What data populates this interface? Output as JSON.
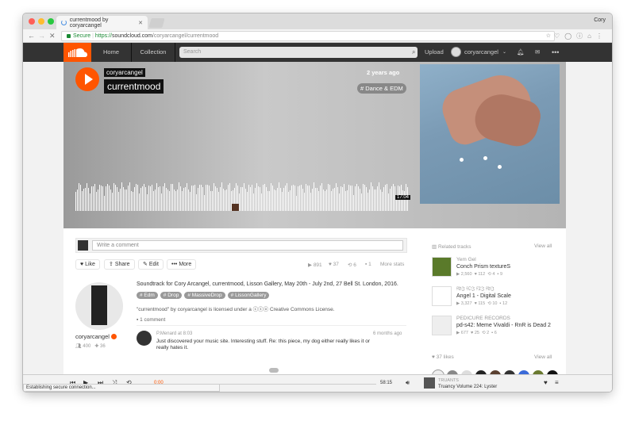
{
  "browser": {
    "tab_title": "currentmood by coryarcangel",
    "tab_close": "✕",
    "user_name": "Cory",
    "secure_label": "Secure",
    "url_scheme": "https://",
    "url_domain": "soundcloud.com",
    "url_path": "/coryarcangel/currentmood",
    "status_text": "Establishing secure connection...",
    "colors": {
      "secure": "#1a8a34",
      "close": "#ff5f57",
      "min": "#febc2e",
      "max": "#28c840"
    }
  },
  "header": {
    "home": "Home",
    "collection": "Collection",
    "search_placeholder": "Search",
    "upload": "Upload",
    "username": "coryarcangel",
    "more": "•••",
    "colors": {
      "bar": "#333333",
      "accent": "#ff5500"
    }
  },
  "hero": {
    "artist": "coryarcangel",
    "title": "currentmood",
    "posted": "2 years ago",
    "genre": "# Dance & EDM",
    "duration": "17:04"
  },
  "comment_box": {
    "placeholder": "Write a comment"
  },
  "actions": {
    "like": "Like",
    "share": "Share",
    "edit": "Edit",
    "more": "More",
    "plays": "891",
    "likes": "37",
    "reposts": "6",
    "comments": "1",
    "more_stats": "More stats"
  },
  "uploader": {
    "name": "coryarcangel",
    "followers": "400",
    "tracks": "36"
  },
  "description": {
    "text": "Soundtrack for Cory Arcangel, currentmood, Lisson Gallery, May 20th - July 2nd, 27 Bell St. London, 2016.",
    "tags": [
      "# Edm",
      "# Drop",
      "# MassiveDrop",
      "# LissonGallery"
    ],
    "license_pre": "\"currentmood\" by",
    "license_user": "coryarcangel",
    "license_mid": "is licensed under a",
    "license_link": "Creative Commons License.",
    "comment_count": "1 comment"
  },
  "comment": {
    "user": "P.Menard",
    "at": "at",
    "time": "8:03",
    "ago": "6 months ago",
    "text": "Just discovered your music site. Interesting stuff. Re: this piece, my dog either really likes it or really hates it."
  },
  "sidebar": {
    "related_title": "Related tracks",
    "view_all": "View all",
    "related": [
      {
        "artist": "Yem Gel",
        "title": "Conch Prism textureS",
        "plays": "2,560",
        "likes": "112",
        "reposts": "4",
        "comments": "9"
      },
      {
        "artist": "𝔣𝔅𝔍 𝔣𝔒𝔍 𝔣𝔗𝔍 𝔣𝔅𝔍",
        "title": "Angel 1 - Digital Scale",
        "plays": "3,327",
        "likes": "115",
        "reposts": "10",
        "comments": "12"
      },
      {
        "artist": "PEDICURE RECORDS",
        "title": "pd-s42: Meme Vivaldi - RnR is Dead 2",
        "plays": "677",
        "likes": "25",
        "reposts": "2",
        "comments": "6"
      }
    ],
    "likes_title": "37 likes",
    "likes_view_all": "View all"
  },
  "player": {
    "current_time": "0:00",
    "total_time": "58:15",
    "now_artist": "TRUANTS",
    "now_title": "Truancy Volume 224: Lyster"
  }
}
